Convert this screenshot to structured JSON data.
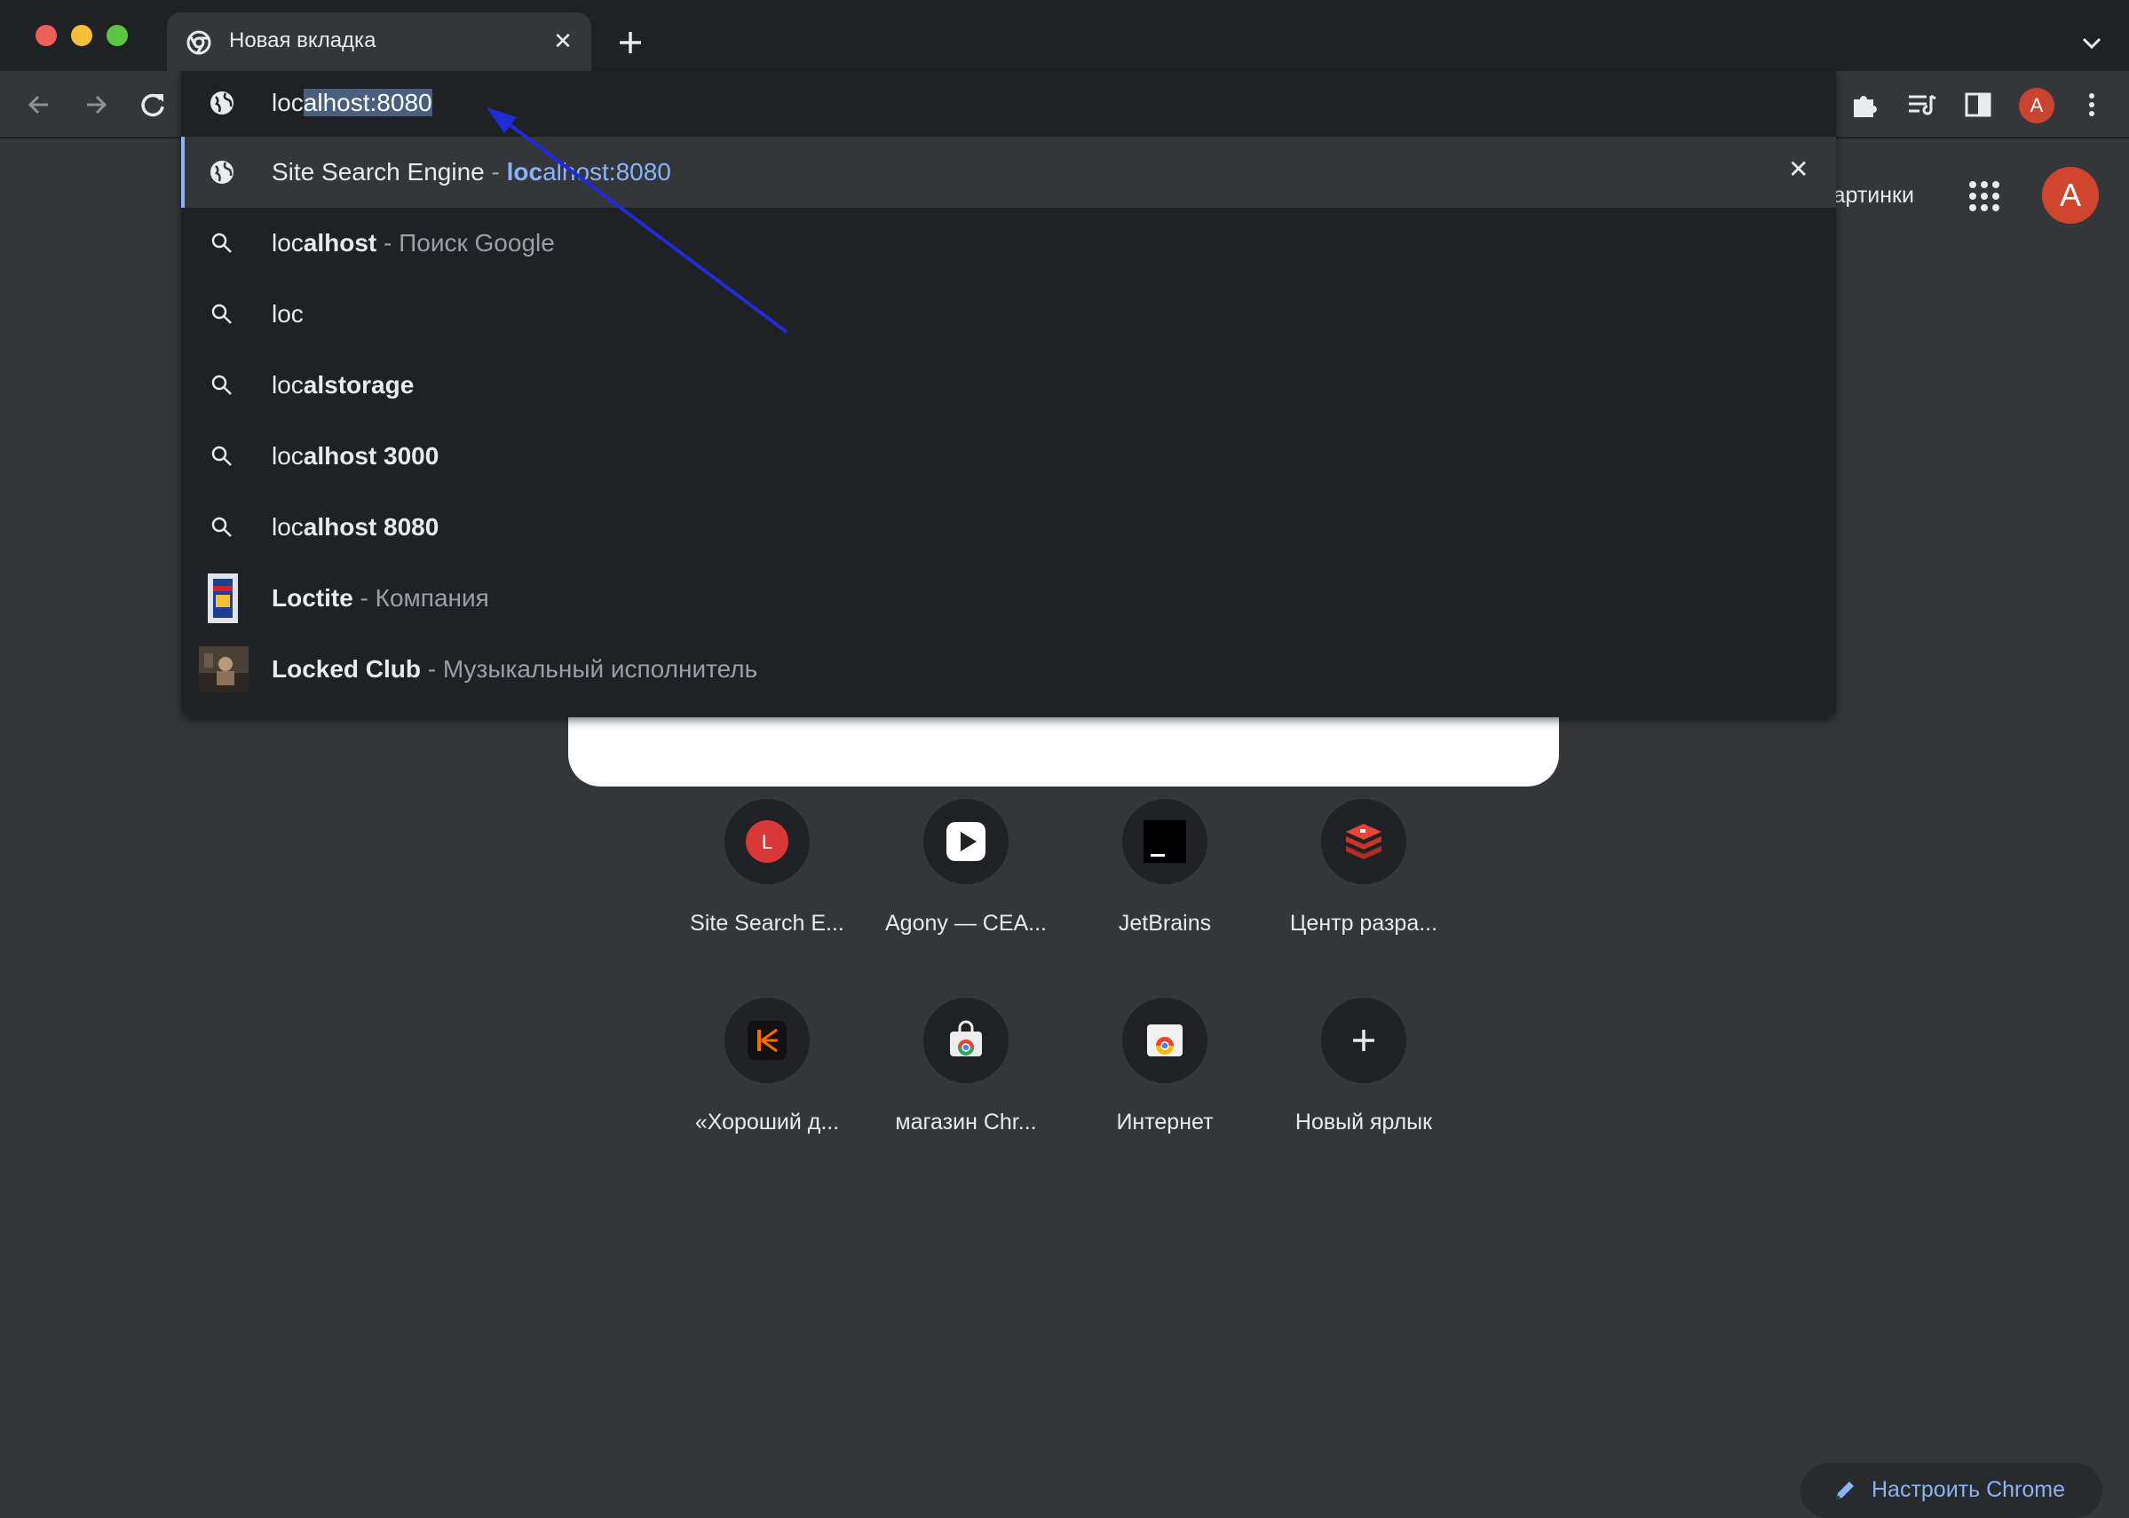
{
  "window": {
    "tab_title": "Новая вкладка",
    "tab_close_glyph": "✕",
    "new_tab_glyph": "+"
  },
  "toolbar": {
    "profile_initial": "A"
  },
  "omnibox": {
    "input_prefix": "loc",
    "input_selected": "alhost:8080",
    "suggestions": [
      {
        "icon": "globe-icon",
        "bold_a": "",
        "plain": "Site Search Engine",
        "sep": " - ",
        "url_prefix": "loc",
        "url_rest": "alhost:8080",
        "desc": "",
        "highlighted": true
      },
      {
        "icon": "search-icon",
        "plain": "loc",
        "bold": "alhost",
        "sep": " - ",
        "desc": "Поиск Google"
      },
      {
        "icon": "search-icon",
        "plain": "loc",
        "bold": "",
        "sep": "",
        "desc": ""
      },
      {
        "icon": "search-icon",
        "plain": "loc",
        "bold": "alstorage",
        "sep": "",
        "desc": ""
      },
      {
        "icon": "search-icon",
        "plain": "loc",
        "bold": "alhost 3000",
        "sep": "",
        "desc": ""
      },
      {
        "icon": "search-icon",
        "plain": "loc",
        "bold": "alhost 8080",
        "sep": "",
        "desc": ""
      },
      {
        "icon": "loctite-thumb",
        "plain": "Loc",
        "bold": "tite",
        "sep": " - ",
        "desc": "Компания"
      },
      {
        "icon": "locked-club-thumb",
        "plain": "Loc",
        "bold": "ked Club",
        "sep": " - ",
        "desc": "Музыкальный исполнитель"
      }
    ],
    "remove_glyph": "✕"
  },
  "ntp": {
    "images_link": "Картинки",
    "avatar_initial": "A",
    "shortcuts": [
      {
        "label": "Site Search E...",
        "icon": "site-search-icon",
        "letter": "L"
      },
      {
        "label": "Agony — CEA...",
        "icon": "agony-icon"
      },
      {
        "label": "JetBrains",
        "icon": "jetbrains-icon"
      },
      {
        "label": "Центр разра...",
        "icon": "redis-icon"
      },
      {
        "label": "«Хороший д...",
        "icon": "kinopoisk-icon"
      },
      {
        "label": "магазин Chr...",
        "icon": "chrome-store-icon"
      },
      {
        "label": "Интернет",
        "icon": "chrome-web-icon"
      },
      {
        "label": "Новый ярлык",
        "icon": "plus-icon"
      }
    ],
    "customize_label": "Настроить Chrome"
  },
  "colors": {
    "accent": "#8ab4f8",
    "arrow": "#1f2bd6",
    "avatar": "#d0452e"
  }
}
